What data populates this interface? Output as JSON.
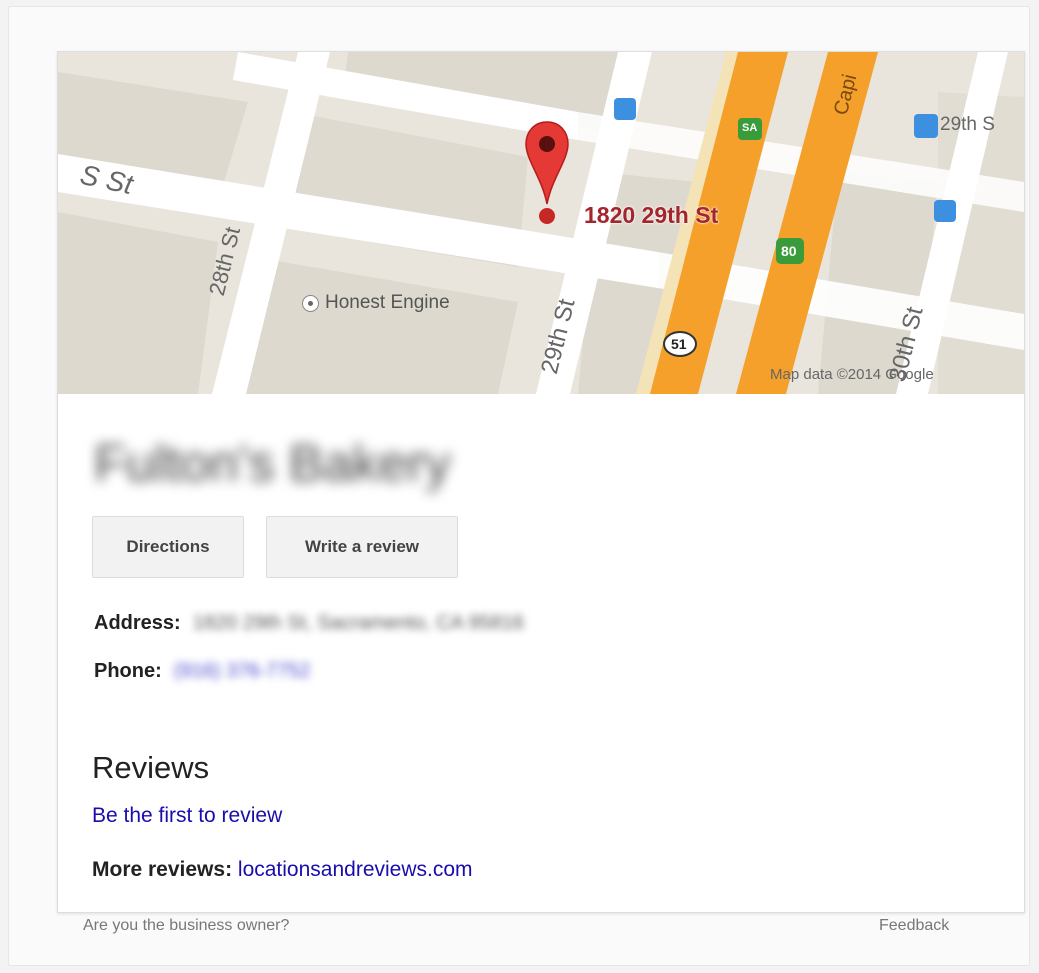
{
  "map": {
    "street_labels": {
      "s_st": "S St",
      "st_28": "28th St",
      "st_29": "29th St",
      "st_30": "30th St",
      "st_29_top": "29th S",
      "capital": "Capi"
    },
    "highway_shields": {
      "i51": "51",
      "us50": "80",
      "hwy_sa": "SA"
    },
    "address_label": "1820 29th St",
    "poi_label": "Honest Engine",
    "attribution": "Map data ©2014 Google",
    "colors": {
      "land": "#e9e5dc",
      "street": "#ffffff",
      "block": "#ddd9cf",
      "highway": "#f5a02a",
      "pin": "#e53935",
      "address": "#a3262d",
      "transit": "#3d8fe0"
    }
  },
  "business": {
    "name": "Fulton's Bakery"
  },
  "actions": {
    "directions": "Directions",
    "write_review": "Write a review"
  },
  "info": {
    "address_label": "Address:",
    "address_value": "1820 29th St, Sacramento, CA 95816",
    "phone_label": "Phone:",
    "phone_value": "(916) 376-7752"
  },
  "reviews": {
    "heading": "Reviews",
    "first_review_link": "Be the first to review",
    "more_label": "More reviews:",
    "more_link": "locationsandreviews.com"
  },
  "footer": {
    "owner": "Are you the business owner?",
    "feedback": "Feedback"
  }
}
